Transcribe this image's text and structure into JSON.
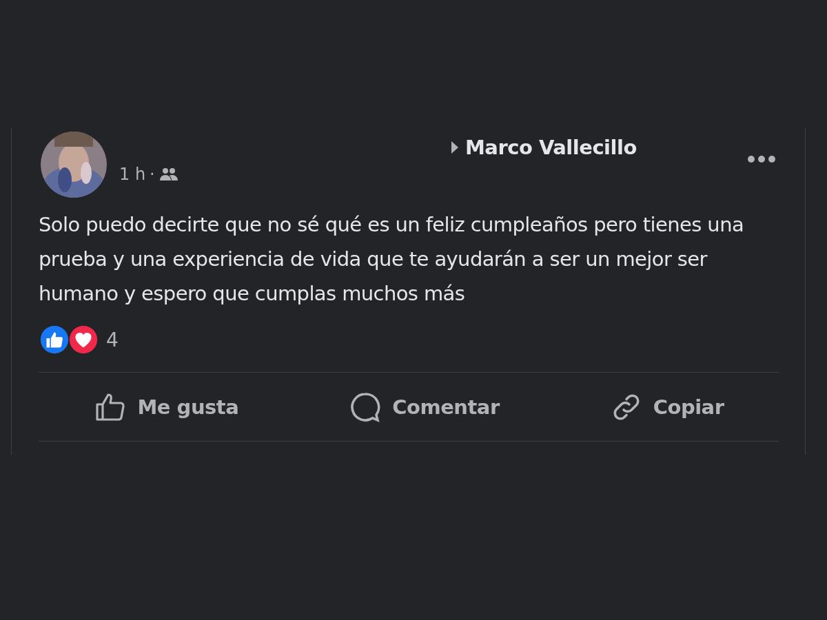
{
  "post": {
    "recipient": "Marco Vallecillo",
    "time": "1 h",
    "separator": "·",
    "text": "Solo puedo decirte que no sé qué es un feliz cumpleaños pero tienes una prueba y una experiencia de vida que te ayudarán a ser un mejor ser humano y espero que cumplas muchos más",
    "reactions": [
      {
        "kind": "like",
        "color": "#1877f2"
      },
      {
        "kind": "love",
        "color": "#f0284a"
      }
    ],
    "reaction_count": "4",
    "actions": [
      {
        "kind": "like",
        "label": "Me gusta"
      },
      {
        "kind": "comment",
        "label": "Comentar"
      },
      {
        "kind": "link",
        "label": "Copiar"
      }
    ]
  }
}
